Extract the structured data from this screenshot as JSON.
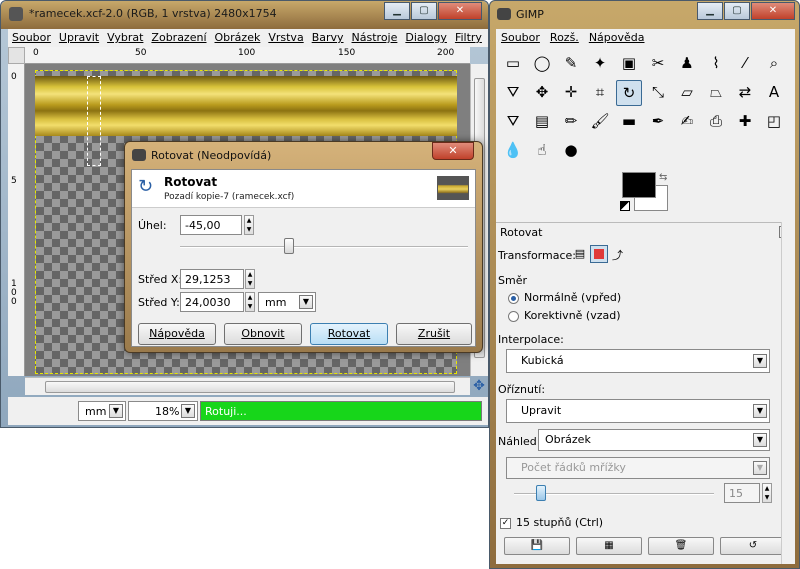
{
  "image_window": {
    "title": "*ramecek.xcf-2.0 (RGB, 1 vrstva) 2480x1754",
    "menu": [
      "Soubor",
      "Upravit",
      "Vybrat",
      "Zobrazení",
      "Obrázek",
      "Vrstva",
      "Barvy",
      "Nástroje",
      "Dialogy",
      "Filtry"
    ],
    "ruler_h_ticks": [
      "0",
      "50",
      "100",
      "150",
      "200"
    ],
    "ruler_v_ticks": [
      "0",
      "5",
      "1 0 0"
    ],
    "unit": "mm",
    "zoom": "18%",
    "progress_text": "Rotuji...",
    "progress_fraction": 1.0,
    "progress_color": "#17d61a"
  },
  "dialog": {
    "title": "Rotovat (Neodpovídá)",
    "header_title": "Rotovat",
    "header_subtitle": "Pozadí kopie-7 (ramecek.xcf)",
    "angle_label": "Úhel:",
    "angle_value": "-45,00",
    "center_x_label": "Střed X:",
    "center_x_value": "29,1253",
    "center_y_label": "Střed Y:",
    "center_y_value": "24,0030",
    "unit": "mm",
    "buttons": {
      "help": "Nápověda",
      "reset": "Obnovit",
      "rotate": "Rotovat",
      "cancel": "Zrušit"
    }
  },
  "toolbox": {
    "title": "GIMP",
    "menu": [
      "Soubor",
      "Rozš.",
      "Nápověda"
    ],
    "tools": [
      {
        "name": "rect-select-icon",
        "glyph": "▭"
      },
      {
        "name": "ellipse-select-icon",
        "glyph": "◯"
      },
      {
        "name": "lasso-icon",
        "glyph": "✎"
      },
      {
        "name": "fuzzy-select-icon",
        "glyph": "✦"
      },
      {
        "name": "color-select-icon",
        "glyph": "▣"
      },
      {
        "name": "scissors-icon",
        "glyph": "✂"
      },
      {
        "name": "foreground-select-icon",
        "glyph": "♟"
      },
      {
        "name": "paths-icon",
        "glyph": "⌇"
      },
      {
        "name": "color-picker-icon",
        "glyph": "⁄"
      },
      {
        "name": "zoom-icon",
        "glyph": "⌕"
      },
      {
        "name": "measure-icon",
        "glyph": "⛛"
      },
      {
        "name": "move-icon",
        "glyph": "✥"
      },
      {
        "name": "align-icon",
        "glyph": "✛"
      },
      {
        "name": "crop-icon",
        "glyph": "⌗"
      },
      {
        "name": "rotate-icon",
        "glyph": "↻"
      },
      {
        "name": "scale-icon",
        "glyph": "⤡"
      },
      {
        "name": "shear-icon",
        "glyph": "▱"
      },
      {
        "name": "perspective-icon",
        "glyph": "⏢"
      },
      {
        "name": "flip-icon",
        "glyph": "⇄"
      },
      {
        "name": "text-icon",
        "glyph": "A"
      },
      {
        "name": "bucket-fill-icon",
        "glyph": "⛛"
      },
      {
        "name": "blend-icon",
        "glyph": "▤"
      },
      {
        "name": "pencil-icon",
        "glyph": "✏"
      },
      {
        "name": "paintbrush-icon",
        "glyph": "🖌"
      },
      {
        "name": "eraser-icon",
        "glyph": "▬"
      },
      {
        "name": "airbrush-icon",
        "glyph": "✒"
      },
      {
        "name": "ink-icon",
        "glyph": "✍"
      },
      {
        "name": "clone-icon",
        "glyph": "⎙"
      },
      {
        "name": "heal-icon",
        "glyph": "✚"
      },
      {
        "name": "perspective-clone-icon",
        "glyph": "◰"
      },
      {
        "name": "blur-icon",
        "glyph": "💧"
      },
      {
        "name": "smudge-icon",
        "glyph": "☝"
      },
      {
        "name": "dodge-burn-icon",
        "glyph": "●"
      }
    ],
    "options": {
      "title": "Rotovat",
      "transform_label": "Transformace:",
      "direction_label": "Směr",
      "direction_normal": "Normálně (vpřed)",
      "direction_corrective": "Korektivně (vzad)",
      "interpolation_label": "Interpolace:",
      "interpolation_value": "Kubická",
      "clipping_label": "Oříznutí:",
      "clipping_value": "Upravit",
      "preview_label": "Náhled:",
      "preview_value": "Obrázek",
      "grid_value": "Počet řádků mřížky",
      "grid_count": "15",
      "steps_label": "15 stupňů  (Ctrl)"
    }
  }
}
